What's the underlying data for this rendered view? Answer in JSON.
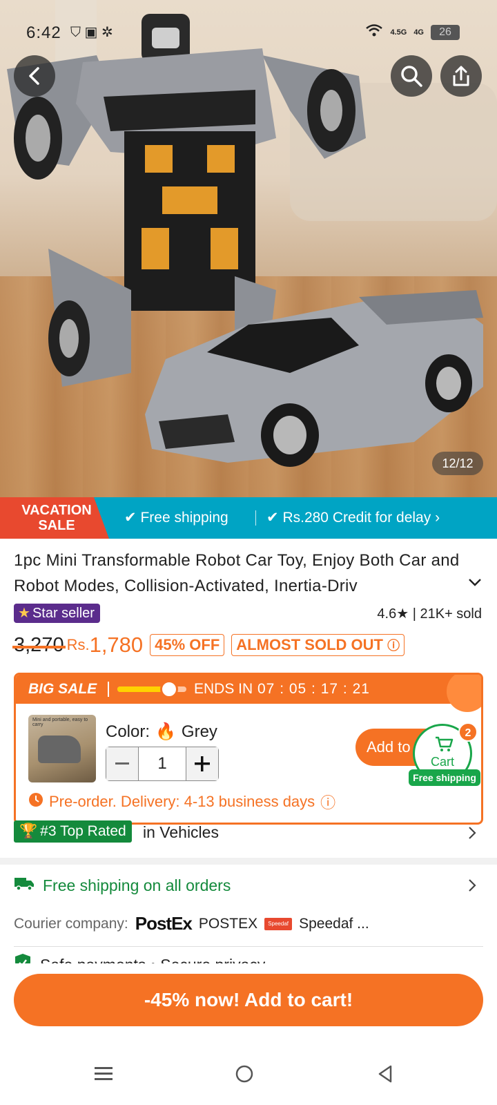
{
  "status_bar": {
    "time": "6:42",
    "network_1": "4.5G",
    "network_2": "4G",
    "battery": "26"
  },
  "hero": {
    "image_counter": "12/12",
    "icons": [
      "back-arrow-icon",
      "search-icon",
      "share-icon"
    ]
  },
  "promo": {
    "vacation_line1": "VACATION",
    "vacation_line2": "SALE",
    "free_shipping": "Free shipping",
    "credit": "Rs.280 Credit for delay",
    "strip_color": "#00a4c4",
    "vacation_color": "#e8492f"
  },
  "product": {
    "title": "1pc Mini Transformable Robot Car Toy, Enjoy Both Car and Robot Modes, Collision-Activated, Inertia-Driv",
    "star_seller": "Star seller",
    "rating": "4.6",
    "sold": "21K+ sold",
    "old_price": "3,270",
    "currency": "Rs.",
    "price": "1,780",
    "discount": "45% OFF",
    "stock_note": "ALMOST SOLD OUT",
    "accent_color": "#f57224"
  },
  "sale": {
    "title": "BIG SALE",
    "ends_label": "ENDS IN",
    "timer": "07 : 05 : 17 : 21",
    "progress": 0.75,
    "thumb_caption": "Mini and portable, easy to carry",
    "color_label": "Color:",
    "color_value": "Grey",
    "quantity": "1",
    "add_to_cart": "Add to cart",
    "preorder": "Pre-order. Delivery: 4-13 business days"
  },
  "cart": {
    "label": "Cart",
    "badge": "2",
    "free_shipping": "Free shipping"
  },
  "rank": {
    "badge": "#3 Top Rated",
    "category": "in Vehicles"
  },
  "shipping": {
    "title": "Free shipping on all orders",
    "courier_label": "Courier company:",
    "postex_logo": "PostEx",
    "postex_name": "POSTEX",
    "speedaf_logo": "Speedaf express",
    "speedaf_name": "Speedaf ...",
    "safe_payments": "Safe payments • Secure privacy"
  },
  "bottom": {
    "cta": "-45% now! Add to cart!"
  }
}
